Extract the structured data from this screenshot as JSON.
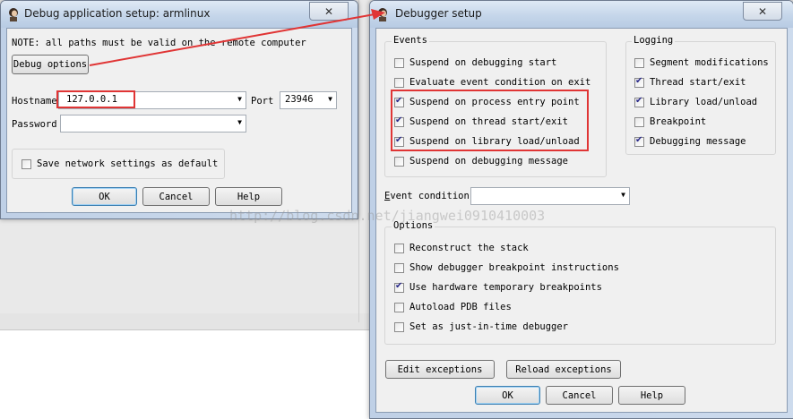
{
  "left_dialog": {
    "title": "Debug application setup: armlinux",
    "close_label": "✕",
    "note": "NOTE: all paths must be valid on the remote computer",
    "debug_options_label": "Debug options",
    "hostname_label": "Hostname",
    "hostname_value": "127.0.0.1",
    "port_label": "Port",
    "port_value": "23946",
    "password_label": "Password",
    "password_value": "",
    "save_default_label": "Save network settings as default",
    "save_default_checked": false,
    "ok_label": "OK",
    "cancel_label": "Cancel",
    "help_label": "Help"
  },
  "right_dialog": {
    "title": "Debugger setup",
    "close_label": "✕",
    "events": {
      "title": "Events",
      "items": [
        {
          "label": "Suspend on debugging start",
          "checked": false
        },
        {
          "label": "Evaluate event condition on exit",
          "checked": false
        },
        {
          "label": "Suspend on process entry point",
          "checked": true
        },
        {
          "label": "Suspend on thread start/exit",
          "checked": true
        },
        {
          "label": "Suspend on library load/unload",
          "checked": true
        },
        {
          "label": "Suspend on debugging message",
          "checked": false
        }
      ]
    },
    "logging": {
      "title": "Logging",
      "items": [
        {
          "label": "Segment modifications",
          "checked": false
        },
        {
          "label": "Thread start/exit",
          "checked": true
        },
        {
          "label": "Library load/unload",
          "checked": true
        },
        {
          "label": "Breakpoint",
          "checked": false
        },
        {
          "label": "Debugging message",
          "checked": true
        }
      ]
    },
    "event_condition_label": "Event condition",
    "event_condition_value": "",
    "options": {
      "title": "Options",
      "items": [
        {
          "label": "Reconstruct the stack",
          "checked": false
        },
        {
          "label": "Show debugger breakpoint instructions",
          "checked": false
        },
        {
          "label": "Use hardware temporary breakpoints",
          "checked": true
        },
        {
          "label": "Autoload PDB files",
          "checked": false
        },
        {
          "label": "Set as just-in-time debugger",
          "checked": false
        }
      ]
    },
    "edit_exceptions_label": "Edit exceptions",
    "reload_exceptions_label": "Reload exceptions",
    "ok_label": "OK",
    "cancel_label": "Cancel",
    "help_label": "Help"
  },
  "watermark": "http://blog.csdn.net/jiangwei0910410003",
  "colors": {
    "annotation_red": "#e03535",
    "title_gradient": "#c5d6ea",
    "dialog_face": "#f0f0f0"
  }
}
